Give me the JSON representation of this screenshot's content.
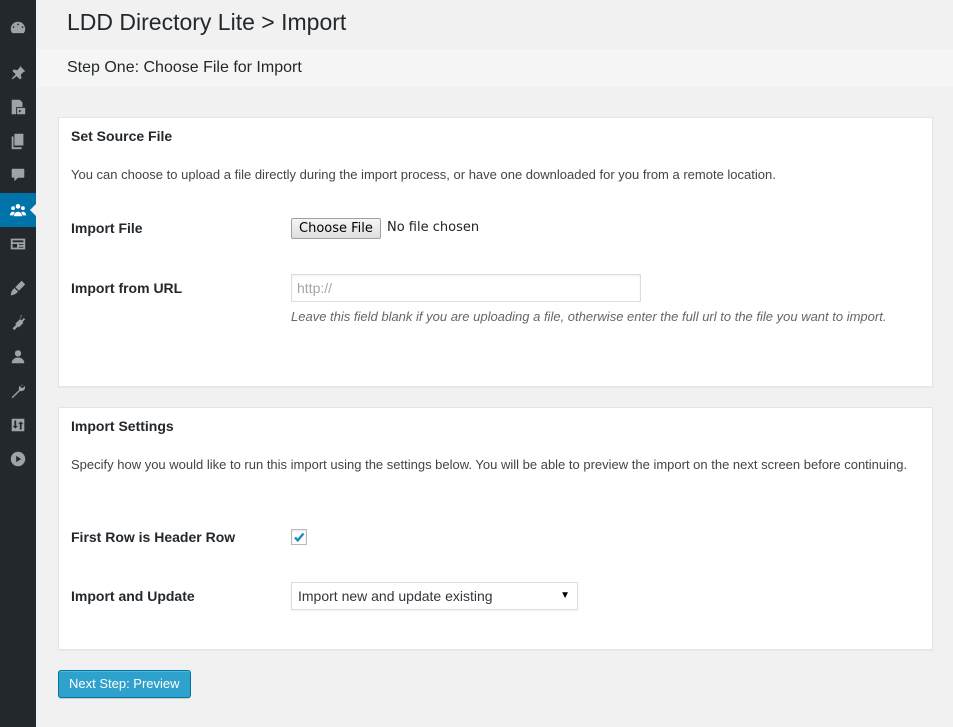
{
  "header": {
    "title": "LDD Directory Lite > Import",
    "step": "Step One: Choose File for Import"
  },
  "sidebar": {
    "icons": [
      "dashboard-icon",
      "pin-icon",
      "media-icon",
      "pages-icon",
      "comments-icon",
      "directory-users-icon",
      "listings-icon",
      "appearance-icon",
      "plugins-icon",
      "users-icon",
      "tools-icon",
      "import-export-icon",
      "play-icon"
    ],
    "current": "directory-users-icon"
  },
  "source_panel": {
    "title": "Set Source File",
    "description": "You can choose to upload a file directly during the import process, or have one downloaded for you from a remote location.",
    "import_file_label": "Import File",
    "choose_file_label": "Choose File",
    "file_status": "No file chosen",
    "url_label": "Import from URL",
    "url_value": "",
    "url_placeholder": "http://",
    "url_help": "Leave this field blank if you are uploading a file, otherwise enter the full url to the file you want to import."
  },
  "settings_panel": {
    "title": "Import Settings",
    "description": "Specify how you would like to run this import using the settings below. You will be able to preview the import on the next screen before continuing.",
    "header_row_label": "First Row is Header Row",
    "header_row_checked": true,
    "update_label": "Import and Update",
    "update_selected": "Import new and update existing",
    "update_caret": "▼"
  },
  "actions": {
    "next_label": "Next Step: Preview"
  },
  "colors": {
    "sidebar_bg": "#23282d",
    "accent": "#0073aa",
    "primary_button": "#2ea2cc",
    "checkmark": "#1e8cbe"
  }
}
